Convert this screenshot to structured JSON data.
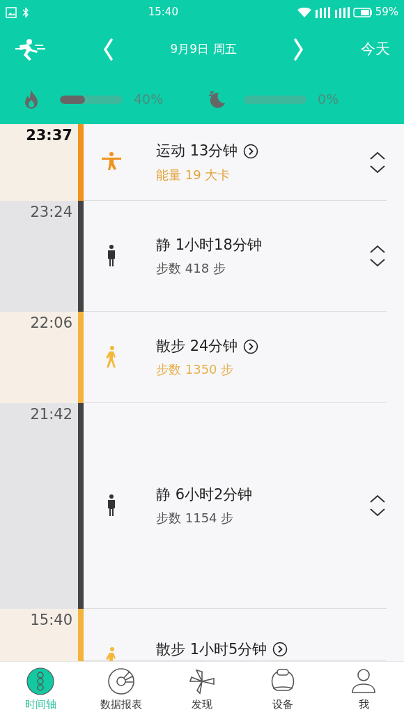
{
  "status_bar": {
    "time": "15:40",
    "battery": "59%"
  },
  "header": {
    "date": "9月9日 周五",
    "today_button": "今天"
  },
  "progress": [
    {
      "kind": "calories",
      "level": 0.4,
      "reading": "40%"
    },
    {
      "kind": "sleep",
      "level": 0.0,
      "reading": "0%"
    }
  ],
  "timeline": [
    {
      "kind": "exercise",
      "time": "23:37",
      "current": true,
      "title": "运动 13分钟",
      "subtitle": "能量 19 大卡",
      "detail_link": true,
      "expandable": true
    },
    {
      "kind": "rest",
      "time": "23:24",
      "current": false,
      "title": "静 1小时18分钟",
      "subtitle": "步数 418 步",
      "detail_link": false,
      "expandable": true
    },
    {
      "kind": "walk",
      "time": "22:06",
      "current": false,
      "title": "散步 24分钟",
      "subtitle": "步数 1350 步",
      "detail_link": true,
      "expandable": false
    },
    {
      "kind": "rest",
      "time": "21:42",
      "current": false,
      "title": "静 6小时2分钟",
      "subtitle": "步数 1154 步",
      "detail_link": false,
      "expandable": true
    },
    {
      "kind": "walk",
      "time": "15:40",
      "current": false,
      "title": "散步 1小时5分钟",
      "detail_link": true,
      "expandable": false
    }
  ],
  "bottom_nav": [
    {
      "kind": "timeline",
      "label": "时间轴",
      "selected": true
    },
    {
      "kind": "reports",
      "label": "数据报表",
      "selected": false
    },
    {
      "kind": "discover",
      "label": "发现",
      "selected": false
    },
    {
      "kind": "device",
      "label": "设备",
      "selected": false
    },
    {
      "kind": "me",
      "label": "我",
      "selected": false
    }
  ]
}
